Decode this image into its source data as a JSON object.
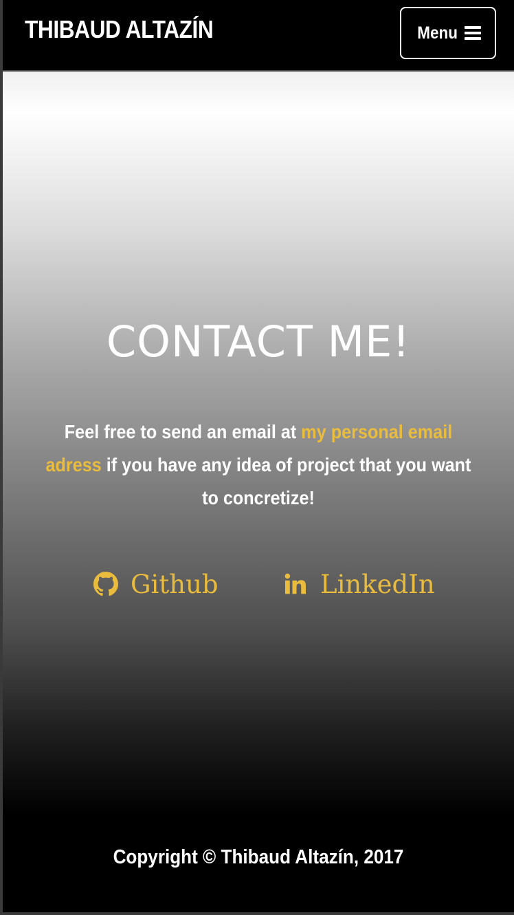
{
  "navbar": {
    "brand": "THIBAUD ALTAZÍN",
    "menu_label": "Menu",
    "menu_icon": "bars-icon"
  },
  "contact": {
    "title": "CONTACT ME!",
    "intro_before": "Feel free to send an email at ",
    "email_link_text": "my personal email adress",
    "intro_after": " if you have any idea of project that you want to concretize!",
    "links": [
      {
        "label": "Github",
        "icon": "github-icon"
      },
      {
        "label": "LinkedIn",
        "icon": "linkedin-icon"
      }
    ]
  },
  "footer": {
    "copyright": "Copyright © Thibaud Altazín, 2017"
  },
  "colors": {
    "accent": "#e9bc3d",
    "text": "#ffffff",
    "background": "#000000"
  }
}
